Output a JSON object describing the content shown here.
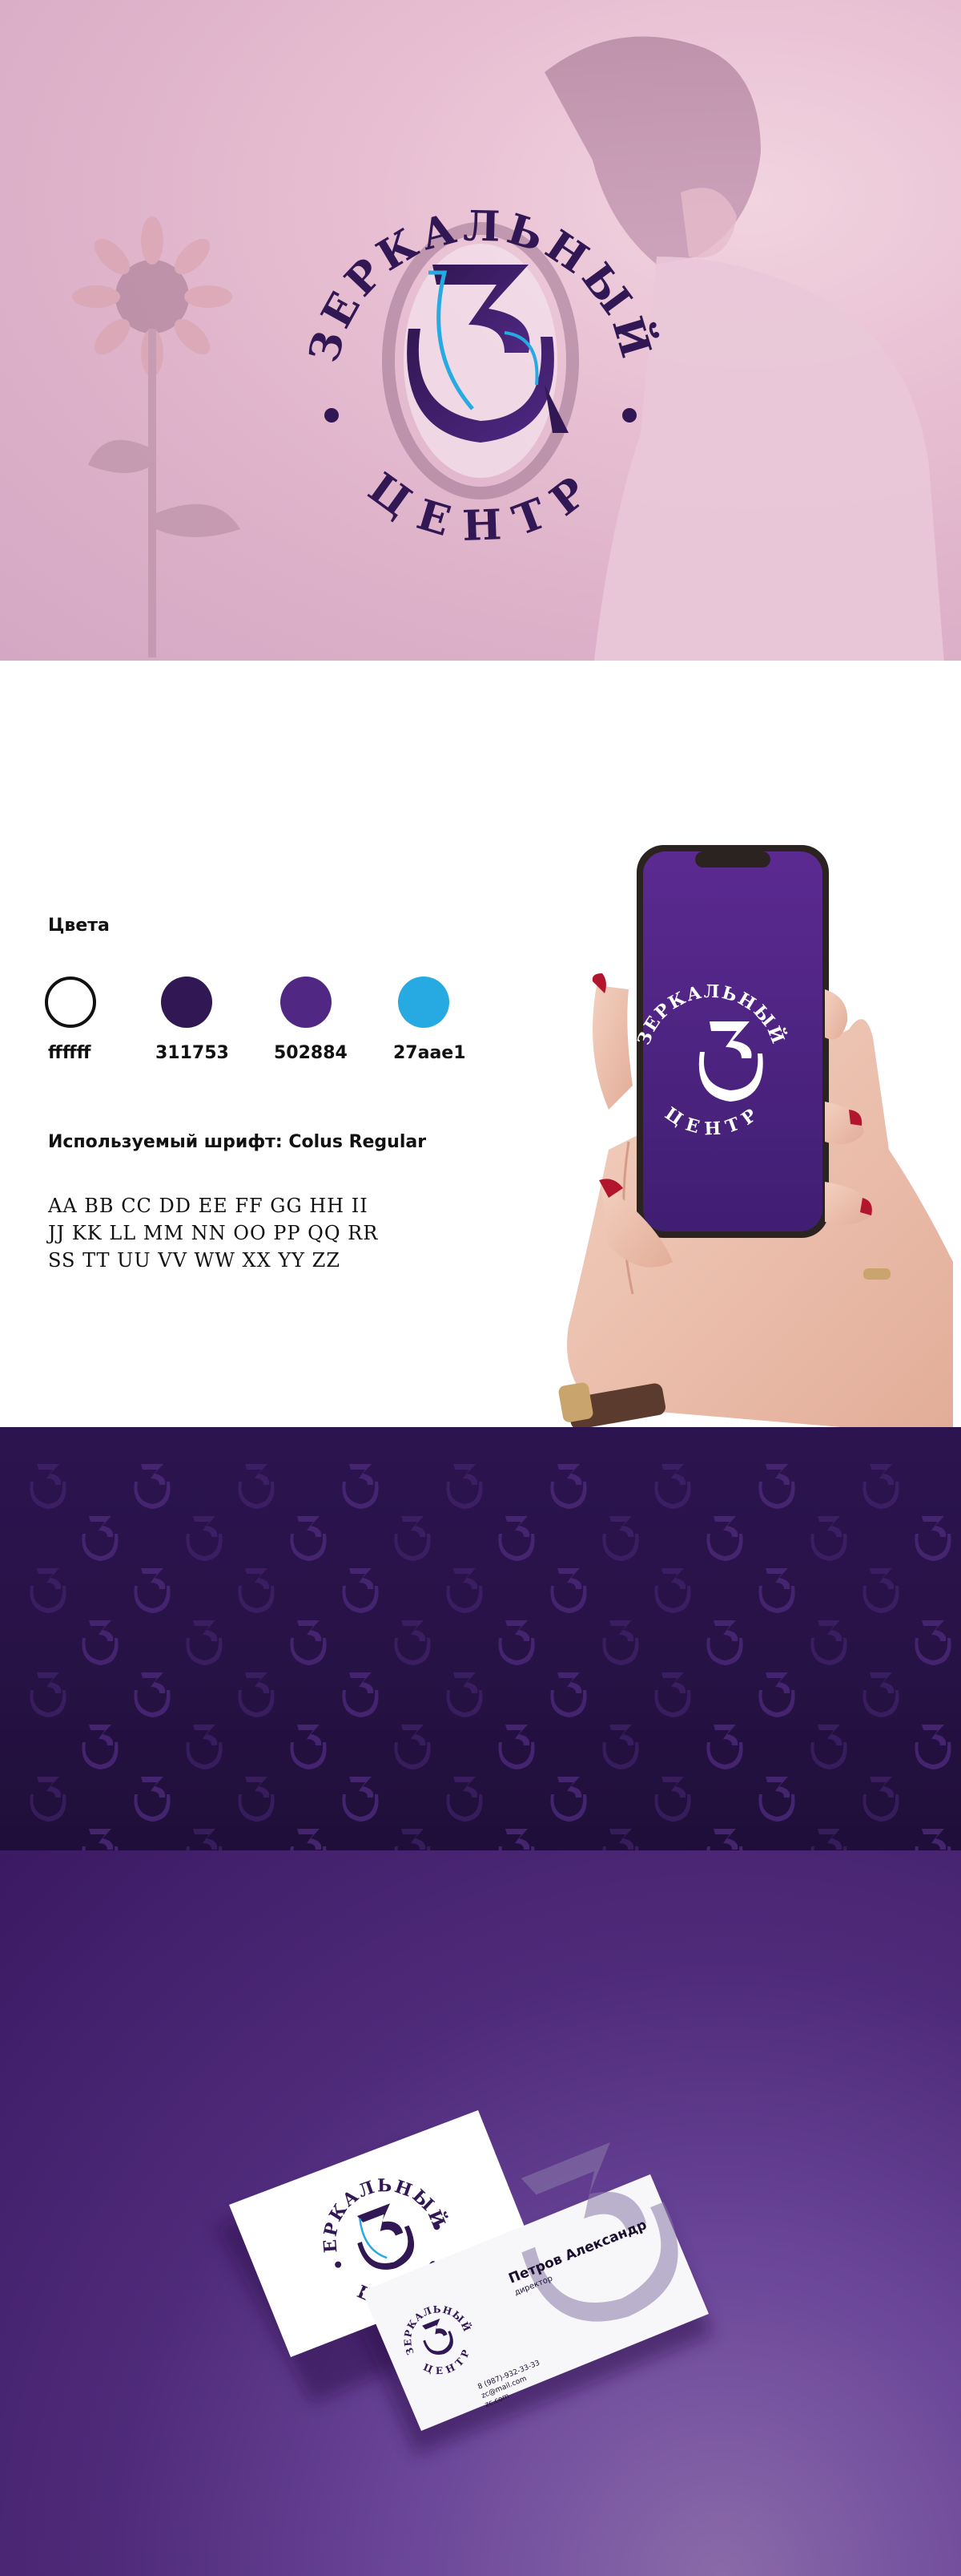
{
  "hero": {
    "logo_top_text": "ЗЕРКАЛЬНЫЙ",
    "logo_bottom_text": "ЦЕНТР",
    "monogram_letters": "ЗЦ"
  },
  "palette": {
    "title": "Цвета",
    "colors": [
      {
        "hex": "#ffffff",
        "label": "ffffff"
      },
      {
        "hex": "#311753",
        "label": "311753"
      },
      {
        "hex": "#502884",
        "label": "502884"
      },
      {
        "hex": "#27aae1",
        "label": "27aae1"
      }
    ]
  },
  "font": {
    "title": "Используемый шрифт: Colus Regular",
    "alphabet_lines": [
      "AA BB CC DD EE FF GG HH II",
      "JJ KK LL MM NN OO PP QQ RR",
      "SS TT UU VV WW XX YY ZZ"
    ]
  },
  "phone": {
    "logo_top_text": "ЗЕРКАЛЬНЫЙ",
    "logo_bottom_text": "ЦЕНТР"
  },
  "card": {
    "logo_top_text": "ЗЕРКАЛЬНЫЙ",
    "logo_bottom_text": "ЦЕНТР",
    "person_name": "Петров Александр",
    "person_role": "директор",
    "phone": "8 (987)-932-33-33",
    "email": "zc@mail.com",
    "site": "zc.com"
  },
  "theme": {
    "dark_purple": "#311753",
    "purple": "#502884",
    "cyan": "#27aae1"
  }
}
